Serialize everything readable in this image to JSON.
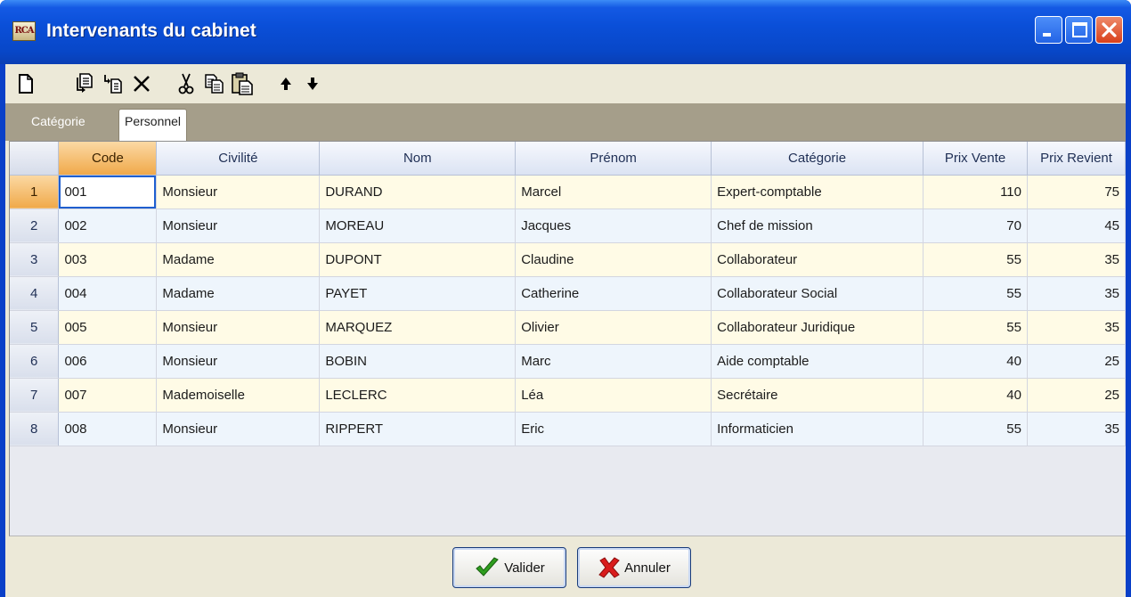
{
  "window": {
    "icon_text": "RCA",
    "title": "Intervenants du cabinet",
    "controls": [
      "minimize-icon",
      "maximize-icon",
      "close-icon"
    ]
  },
  "toolbar": {
    "tools": [
      "new-document-icon",
      "insert-row-icon",
      "insert-child-icon",
      "delete-icon",
      "cut-icon",
      "copy-icon",
      "paste-icon",
      "move-up-icon",
      "move-down-icon"
    ]
  },
  "tabs": [
    {
      "label": "Catégorie",
      "active": false
    },
    {
      "label": "Personnel",
      "active": true
    }
  ],
  "grid": {
    "columns": [
      "Code",
      "Civilité",
      "Nom",
      "Prénom",
      "Catégorie",
      "Prix Vente",
      "Prix Revient"
    ],
    "selected_column": "Code",
    "rows": [
      {
        "num": "1",
        "code": "001",
        "civilite": "Monsieur",
        "nom": "DURAND",
        "prenom": "Marcel",
        "categorie": "Expert-comptable",
        "prix_vente": "110",
        "prix_revient": "75"
      },
      {
        "num": "2",
        "code": "002",
        "civilite": "Monsieur",
        "nom": "MOREAU",
        "prenom": "Jacques",
        "categorie": "Chef de mission",
        "prix_vente": "70",
        "prix_revient": "45"
      },
      {
        "num": "3",
        "code": "003",
        "civilite": "Madame",
        "nom": "DUPONT",
        "prenom": "Claudine",
        "categorie": "Collaborateur",
        "prix_vente": "55",
        "prix_revient": "35"
      },
      {
        "num": "4",
        "code": "004",
        "civilite": "Madame",
        "nom": "PAYET",
        "prenom": "Catherine",
        "categorie": "Collaborateur Social",
        "prix_vente": "55",
        "prix_revient": "35"
      },
      {
        "num": "5",
        "code": "005",
        "civilite": "Monsieur",
        "nom": "MARQUEZ",
        "prenom": "Olivier",
        "categorie": "Collaborateur Juridique",
        "prix_vente": "55",
        "prix_revient": "35"
      },
      {
        "num": "6",
        "code": "006",
        "civilite": "Monsieur",
        "nom": "BOBIN",
        "prenom": "Marc",
        "categorie": "Aide comptable",
        "prix_vente": "40",
        "prix_revient": "25"
      },
      {
        "num": "7",
        "code": "007",
        "civilite": "Mademoiselle",
        "nom": "LECLERC",
        "prenom": "Léa",
        "categorie": "Secrétaire",
        "prix_vente": "40",
        "prix_revient": "25"
      },
      {
        "num": "8",
        "code": "008",
        "civilite": "Monsieur",
        "nom": "RIPPERT",
        "prenom": "Eric",
        "categorie": "Informaticien",
        "prix_vente": "55",
        "prix_revient": "35"
      }
    ]
  },
  "buttons": {
    "ok": {
      "label": "Valider",
      "icon": "checkmark-icon"
    },
    "cancel": {
      "label": "Annuler",
      "icon": "red-x-icon"
    }
  },
  "colors": {
    "titlebar": "#0a4fd8",
    "window_frame": "#0a40c8",
    "selected_header": "#f0a94a",
    "row_odd": "#fffbe6",
    "row_even": "#eef5fc",
    "tabstrip": "#a59e8a"
  }
}
